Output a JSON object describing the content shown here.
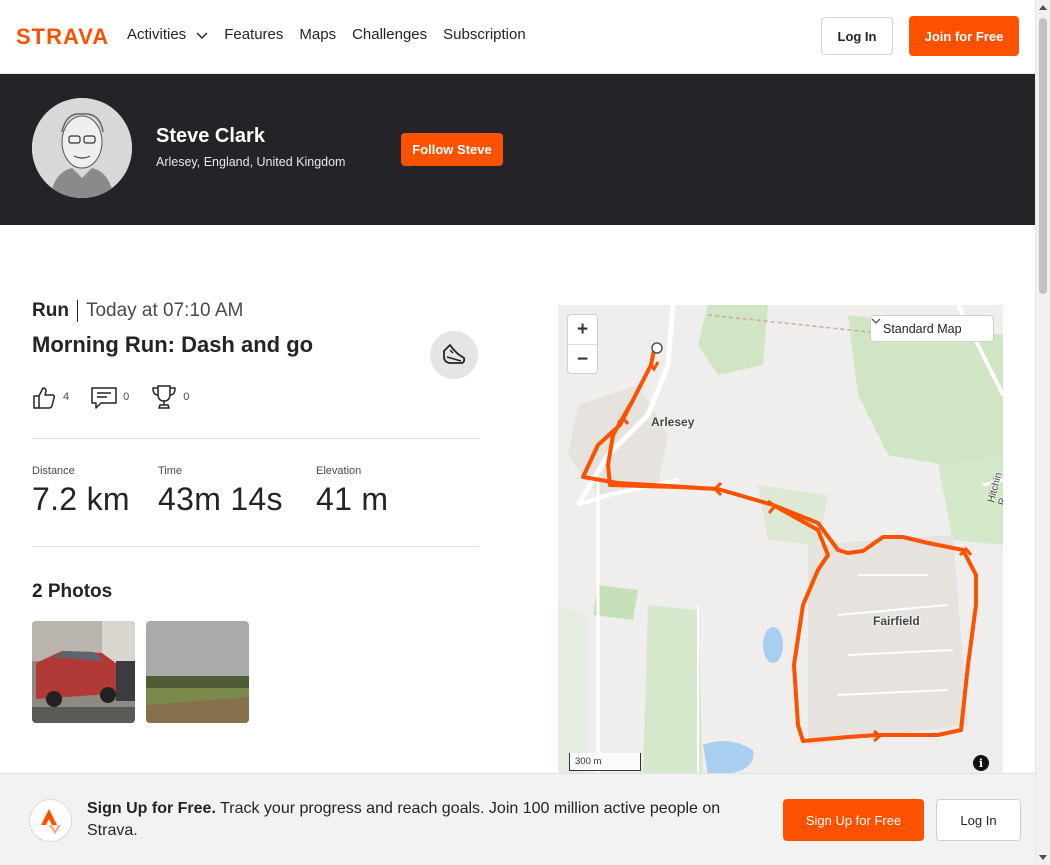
{
  "nav": {
    "logo_text": "STRAVA",
    "items": [
      "Activities",
      "Features",
      "Maps",
      "Challenges",
      "Subscription"
    ],
    "login": "Log In",
    "join": "Join for Free"
  },
  "athlete": {
    "name": "Steve Clark",
    "location": "Arlesey, England, United Kingdom",
    "follow": "Follow Steve"
  },
  "activity": {
    "type": "Run",
    "time": "Today at 07:10 AM",
    "title": "Morning Run: Dash and go",
    "kudos": "4",
    "comments": "0",
    "achievements": "0",
    "stats": [
      {
        "label": "Distance",
        "value": "7.2 km"
      },
      {
        "label": "Time",
        "value": "43m 14s"
      },
      {
        "label": "Elevation",
        "value": "41 m"
      }
    ],
    "photos_title": "2 Photos"
  },
  "map": {
    "style": "Standard Map",
    "zoom_in": "+",
    "zoom_out": "−",
    "scale": "300 m",
    "labels": {
      "town1": "Arlesey",
      "town2": "Fairfield",
      "road": "Hitchin R"
    },
    "info": "i"
  },
  "banner": {
    "bold": "Sign Up for Free.",
    "text": "Track your progress and reach goals. Join 100 million active people on Strava.",
    "signup": "Sign Up for Free",
    "login": "Log In"
  },
  "colors": {
    "brand": "#fc5200",
    "header_bg": "#242428",
    "route": "#fc5200"
  }
}
